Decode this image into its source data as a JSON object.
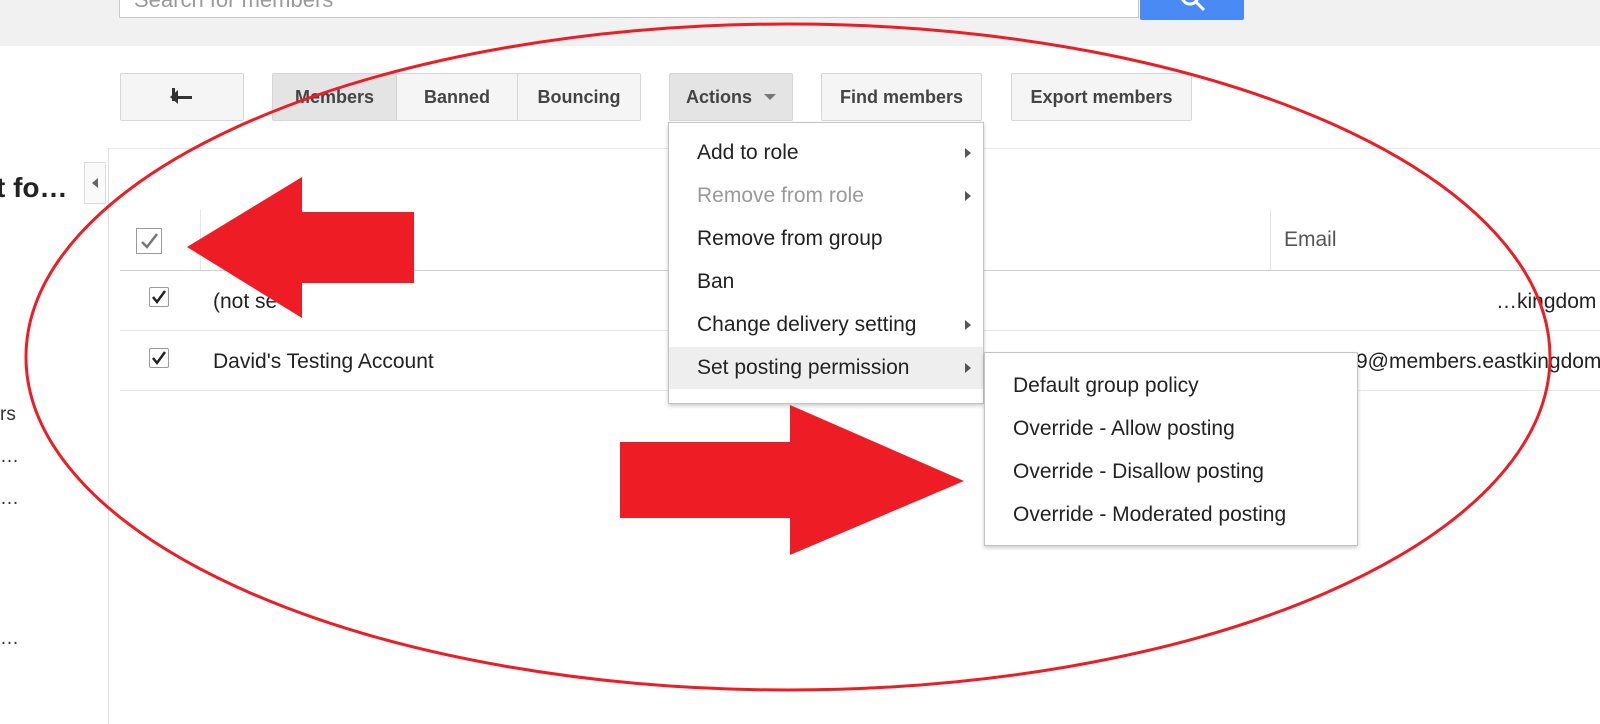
{
  "search": {
    "placeholder": "Search for members"
  },
  "toolbar": {
    "back_icon": "back-arrow-icon",
    "tabs": [
      {
        "label": "Members",
        "selected": true
      },
      {
        "label": "Banned",
        "selected": false
      },
      {
        "label": "Bouncing",
        "selected": false
      }
    ],
    "actions_label": "Actions",
    "find_label": "Find members",
    "export_label": "Export members"
  },
  "left_panel": {
    "title": "t fo…",
    "items": [
      "rs",
      "…",
      "…",
      "…"
    ]
  },
  "table": {
    "columns": {
      "email": "Email"
    },
    "rows": [
      {
        "name": "(not se",
        "email": "…kingdom",
        "checked": true
      },
      {
        "name": "David's Testing Account",
        "email": "9@members.eastkingdom",
        "checked": true
      }
    ]
  },
  "actions_menu": {
    "items": [
      {
        "label": "Add to role",
        "submenu": true,
        "disabled": false
      },
      {
        "label": "Remove from role",
        "submenu": true,
        "disabled": true
      },
      {
        "label": "Remove from group",
        "submenu": false,
        "disabled": false
      },
      {
        "label": "Ban",
        "submenu": false,
        "disabled": false
      },
      {
        "label": "Change delivery setting",
        "submenu": true,
        "disabled": false
      },
      {
        "label": "Set posting permission",
        "submenu": true,
        "disabled": false,
        "active": true
      }
    ]
  },
  "posting_submenu": {
    "items": [
      "Default group policy",
      "Override - Allow posting",
      "Override - Disallow posting",
      "Override - Moderated posting"
    ]
  },
  "colors": {
    "search_button": "#4a8af4",
    "annotation_red": "#ee1c25"
  }
}
